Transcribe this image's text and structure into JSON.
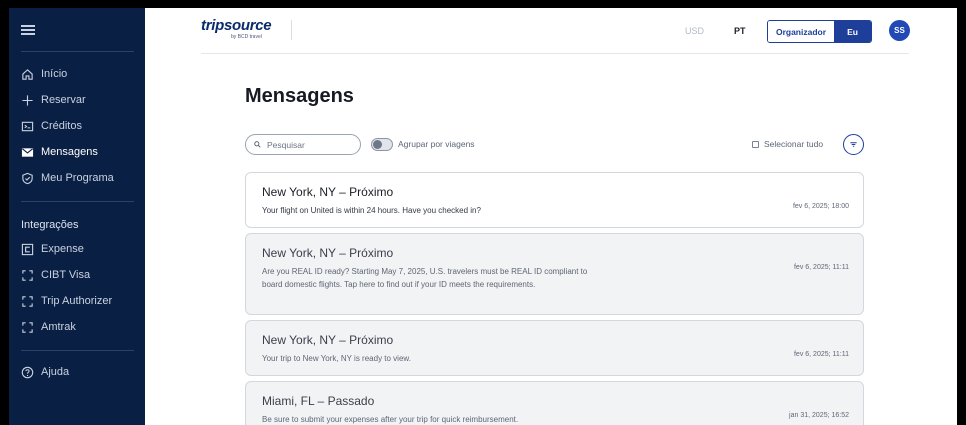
{
  "sidebar": {
    "menu_icon": "hamburger-icon",
    "items": [
      {
        "label": "Início",
        "icon": "home-icon"
      },
      {
        "label": "Reservar",
        "icon": "plus-icon"
      },
      {
        "label": "Créditos",
        "icon": "ticket-icon"
      },
      {
        "label": "Mensagens",
        "icon": "mail-icon"
      },
      {
        "label": "Meu Programa",
        "icon": "shield-check-icon"
      }
    ],
    "integrations_title": "Integrações",
    "integrations": [
      {
        "label": "Expense",
        "icon": "expense-c-icon"
      },
      {
        "label": "CIBT Visa",
        "icon": "bracket-icon"
      },
      {
        "label": "Trip Authorizer",
        "icon": "bracket-icon"
      },
      {
        "label": "Amtrak",
        "icon": "bracket-icon"
      }
    ],
    "help": {
      "label": "Ajuda",
      "icon": "help-circle-icon"
    }
  },
  "header": {
    "logo_main": "tripsource",
    "logo_sub": "by BCD travel",
    "currency": "USD",
    "language": "PT",
    "role_organizer": "Organizador",
    "role_me": "Eu",
    "avatar_initials": "SS"
  },
  "main": {
    "title": "Mensagens",
    "search_placeholder": "Pesquisar",
    "group_by_trips_label": "Agrupar por viagens",
    "select_all_label": "Selecionar tudo",
    "messages": [
      {
        "title": "New York, NY – Próximo",
        "body": "Your flight on United is within 24 hours. Have you checked in?",
        "date": "fev 6, 2025; 18:00",
        "unread": true
      },
      {
        "title": "New York, NY – Próximo",
        "body": "Are you REAL ID ready? Starting May 7, 2025, U.S. travelers must be REAL ID compliant to board domestic flights. Tap here to find out if your ID meets the requirements.",
        "date": "fev 6, 2025; 11:11",
        "unread": false
      },
      {
        "title": "New York, NY – Próximo",
        "body": "Your trip to New York, NY is ready to view.",
        "date": "fev 6, 2025; 11:11",
        "unread": false
      },
      {
        "title": "Miami, FL – Passado",
        "body": "Be sure to submit your expenses after your trip for quick reimbursement.",
        "date": "jan 31, 2025; 16:52",
        "unread": false
      }
    ]
  },
  "colors": {
    "sidebar_bg": "#0a1f44",
    "accent": "#1d3f9a",
    "avatar_bg": "#2148b5"
  }
}
